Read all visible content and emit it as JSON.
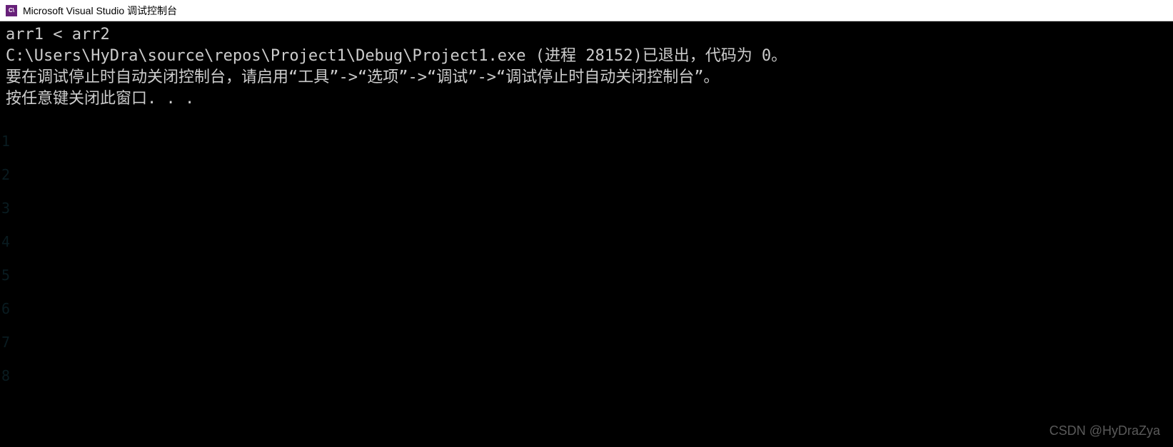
{
  "titleBar": {
    "iconText": "C\\",
    "title": "Microsoft Visual Studio 调试控制台"
  },
  "console": {
    "lines": [
      "arr1 < arr2",
      "C:\\Users\\HyDra\\source\\repos\\Project1\\Debug\\Project1.exe (进程 28152)已退出，代码为 0。",
      "要在调试停止时自动关闭控制台，请启用“工具”->“选项”->“调试”->“调试停止时自动关闭控制台”。",
      "按任意键关闭此窗口. . ."
    ]
  },
  "lineNumbers": [
    "1",
    "2",
    "3",
    "4",
    "5",
    "6",
    "7",
    "8"
  ],
  "watermark": "CSDN @HyDraZya"
}
